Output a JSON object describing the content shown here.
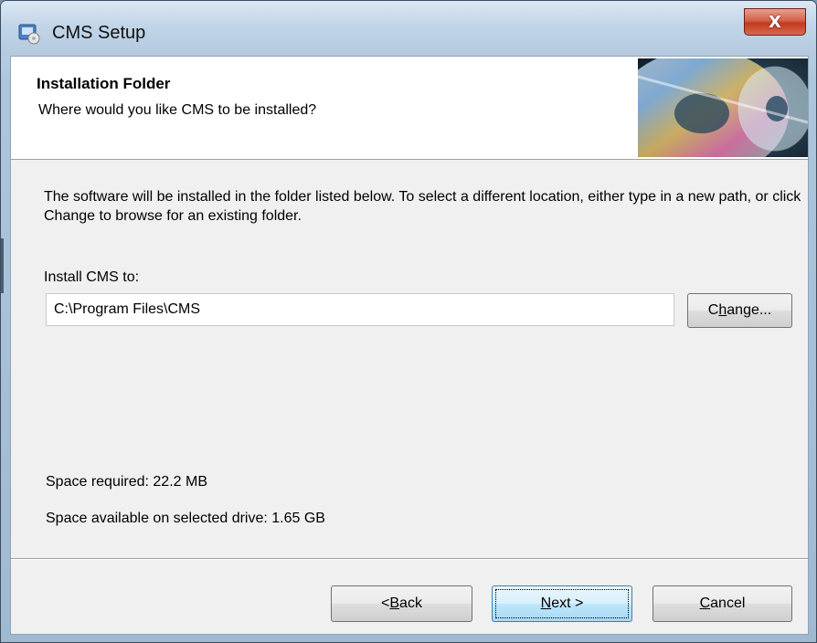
{
  "window": {
    "title": "CMS Setup",
    "close_symbol": "X"
  },
  "header": {
    "title": "Installation Folder",
    "subtitle": "Where would you like CMS to be installed?",
    "image_icon": "cd-disc-image"
  },
  "main": {
    "description": "The software will be installed in the folder listed below. To select a different location, either type in a new path, or click Change to browse for an existing folder.",
    "install_label": "Install CMS to:",
    "install_path": "C:\\Program Files\\CMS",
    "change_button": {
      "pre": "C",
      "accel": "h",
      "post": "ange..."
    },
    "space_required": "Space required: 22.2 MB",
    "space_available": "Space available on selected drive: 1.65 GB"
  },
  "footer": {
    "back_button": {
      "pre": "< ",
      "accel": "B",
      "post": "ack"
    },
    "next_button": {
      "pre": "",
      "accel": "N",
      "post": "ext >"
    },
    "cancel_button": {
      "pre": "",
      "accel": "C",
      "post": "ancel"
    }
  },
  "colors": {
    "title_bar": "#c2d5e8",
    "client_background": "#f0f0f0",
    "close_button": "#c23a1e",
    "default_button": "#3c7fb1"
  }
}
